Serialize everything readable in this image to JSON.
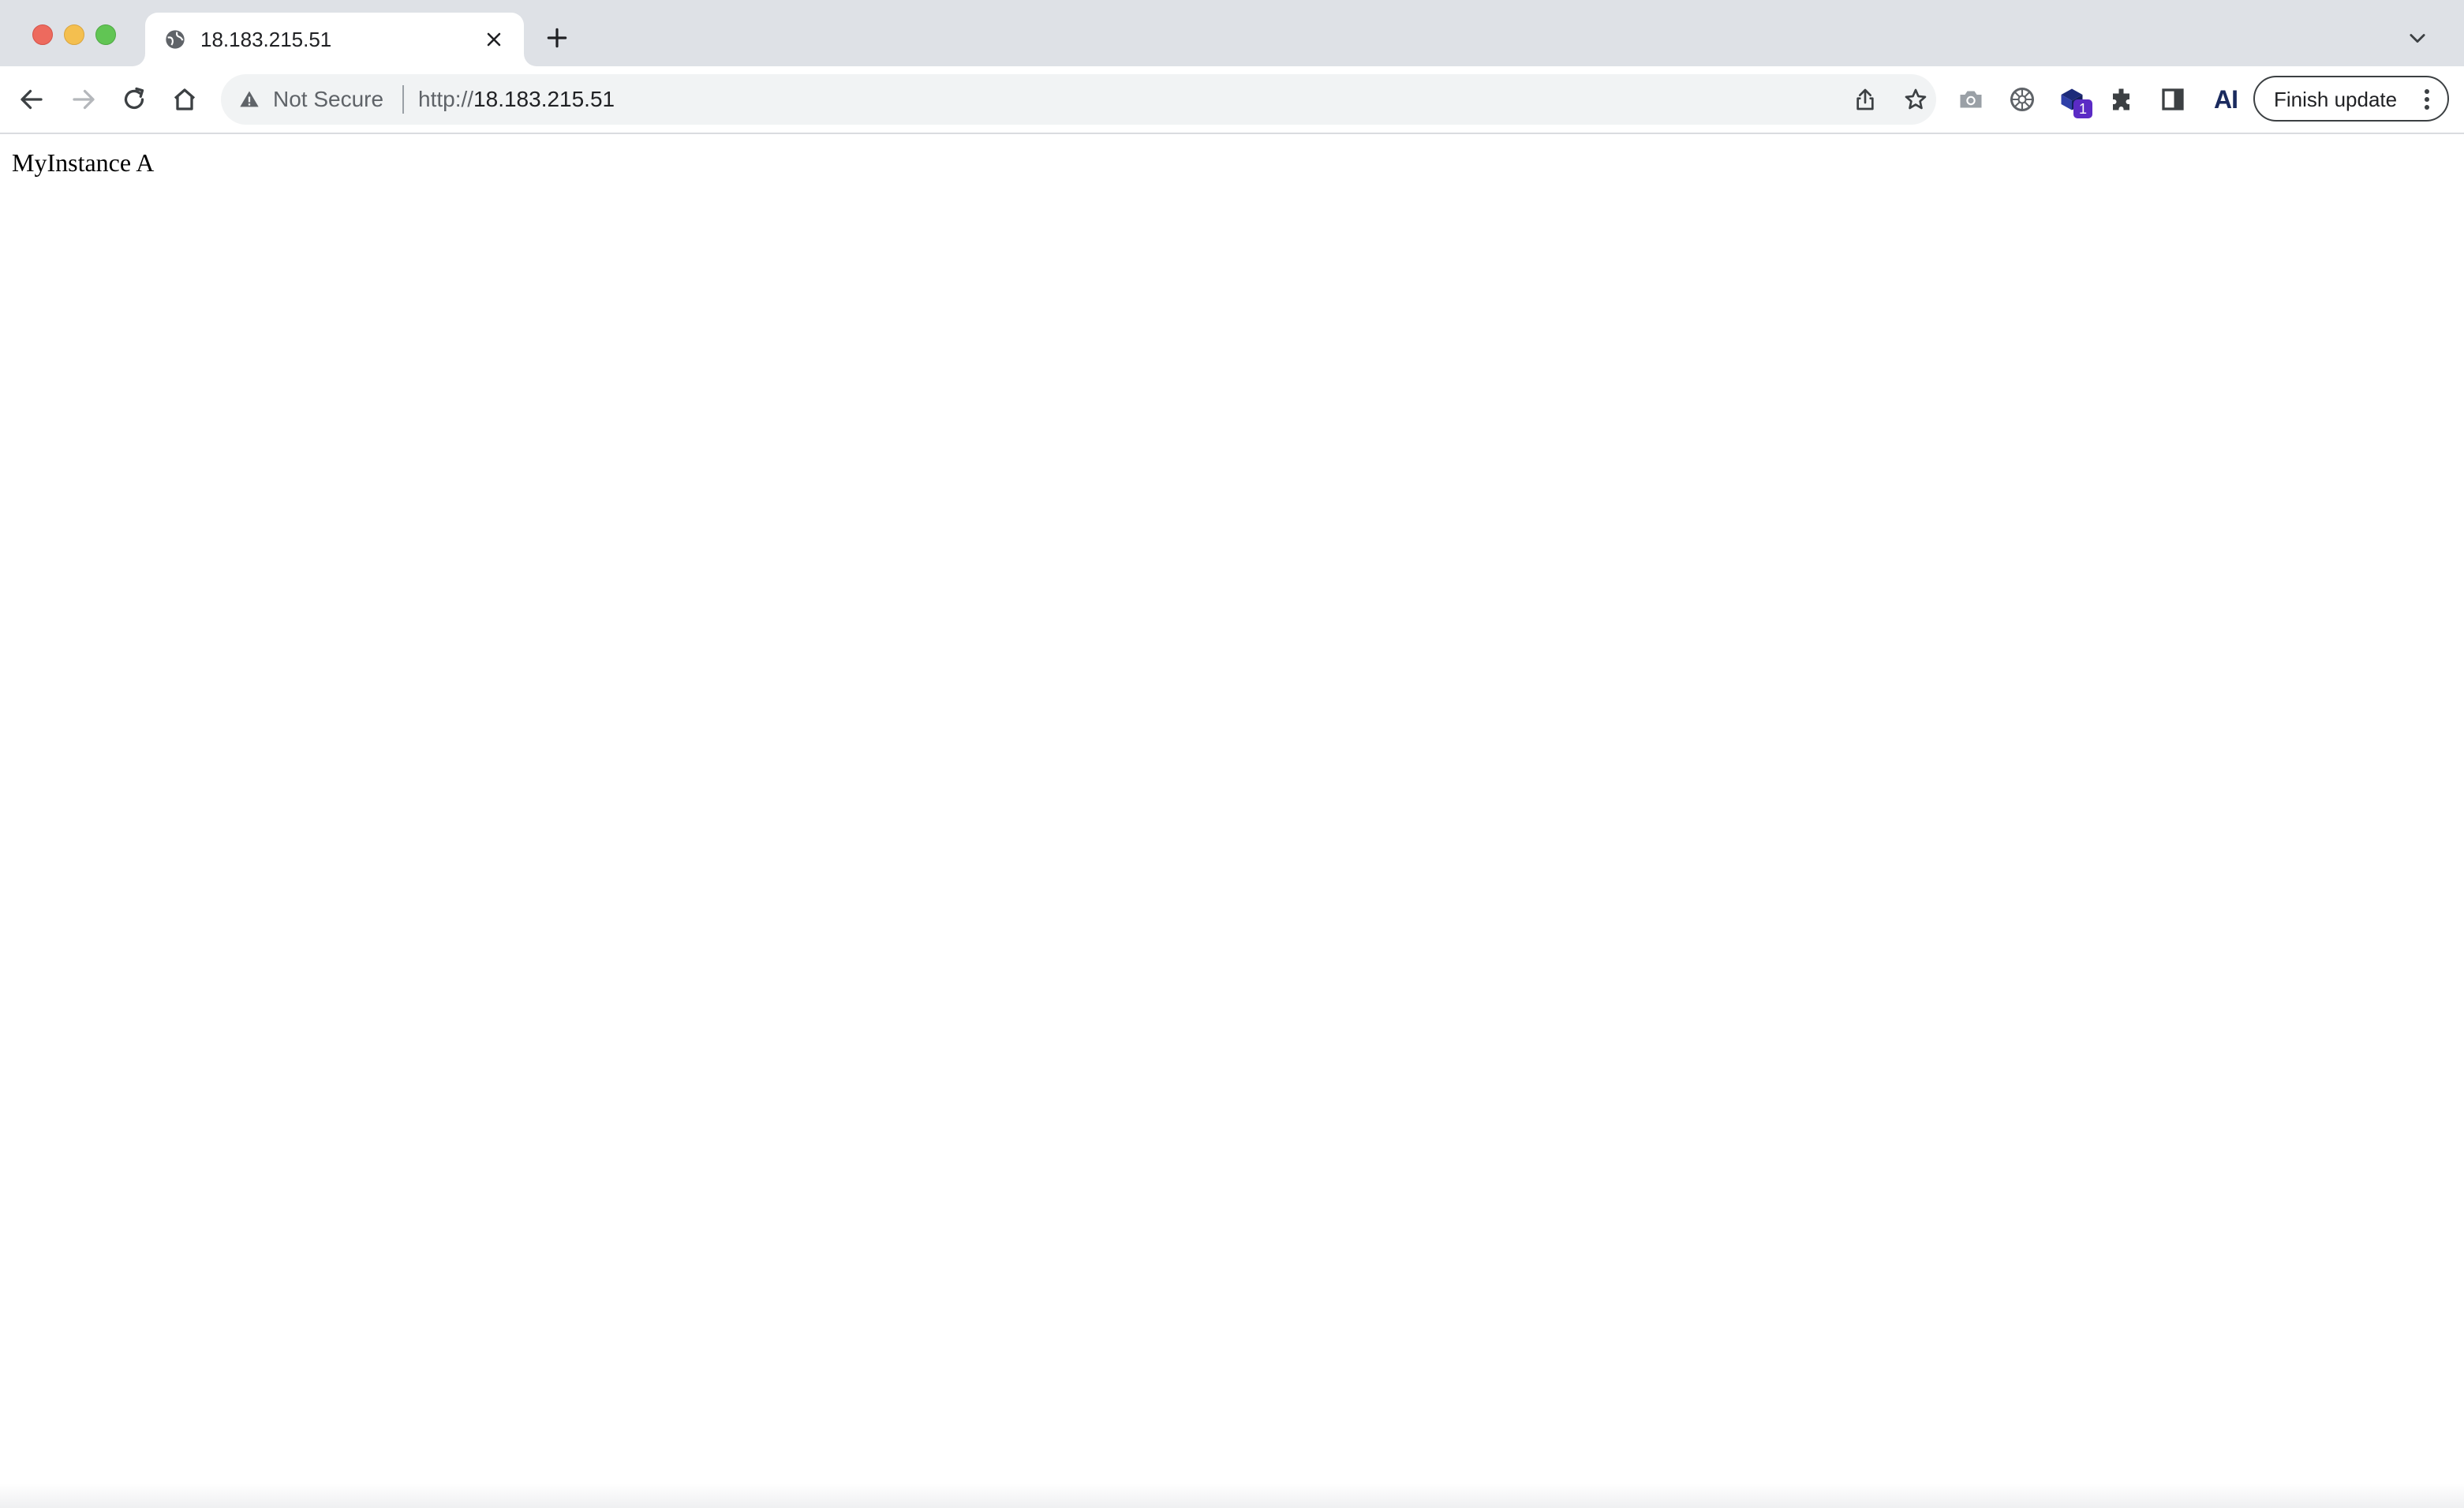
{
  "window": {
    "controls": [
      "close",
      "minimize",
      "zoom"
    ]
  },
  "tab": {
    "title": "18.183.215.51",
    "favicon": "globe-icon"
  },
  "toolbar": {
    "security_label": "Not Secure",
    "url_scheme": "http://",
    "url_host": "18.183.215.51",
    "extension_badge": "1",
    "ai_extension_label": "AI",
    "finish_update_label": "Finish update"
  },
  "page": {
    "body_text": "MyInstance A"
  },
  "colors": {
    "tabstrip_bg": "#dee1e6",
    "omnibox_bg": "#f1f3f4",
    "badge_bg": "#5b2bc5",
    "close_red": "#ed6a5e",
    "minimize_yellow": "#f4bf4f",
    "zoom_green": "#61c554"
  }
}
